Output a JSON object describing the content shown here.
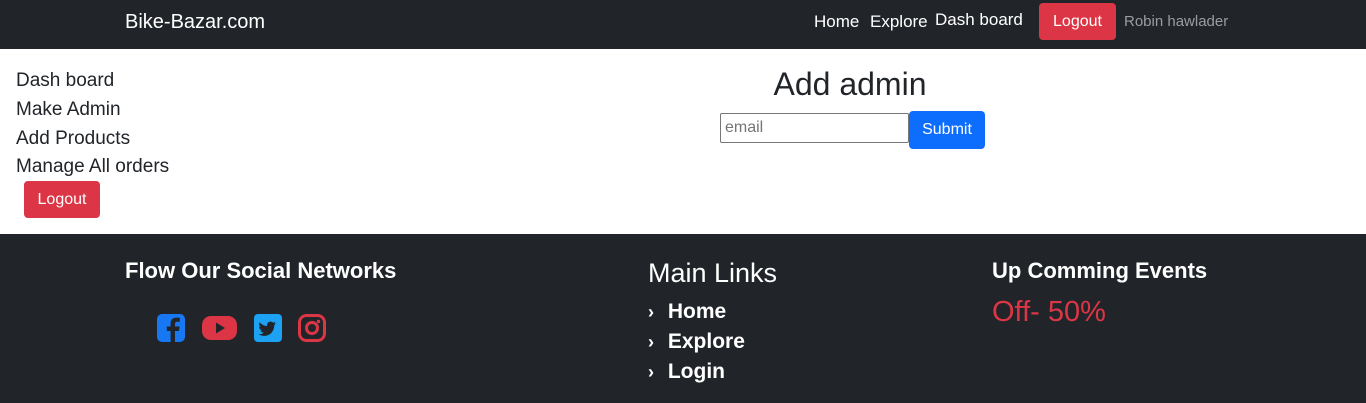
{
  "navbar": {
    "brand": "Bike-Bazar.com",
    "links": [
      "Home",
      "Explore",
      "Dash board"
    ],
    "logout_label": "Logout",
    "user_name": "Robin hawlader"
  },
  "sidebar": {
    "items": [
      "Dash board",
      "Make Admin",
      "Add Products",
      "Manage All orders"
    ],
    "logout_label": "Logout"
  },
  "main": {
    "title": "Add admin",
    "email_placeholder": "email",
    "email_value": "",
    "submit_label": "Submit"
  },
  "footer": {
    "social_heading": "Flow Our Social Networks",
    "social_icons": [
      "facebook-icon",
      "youtube-icon",
      "twitter-icon",
      "instagram-icon"
    ],
    "links_heading": "Main Links",
    "links": [
      "Home",
      "Explore",
      "Login"
    ],
    "events_heading": "Up Comming Events",
    "offer": "Off- 50%"
  },
  "colors": {
    "dark": "#212529",
    "danger": "#dc3545",
    "primary": "#0d6efd",
    "facebook": "#1877f2",
    "youtube": "#dc3545",
    "twitter": "#1da1f2",
    "instagram": "#dc3545"
  }
}
